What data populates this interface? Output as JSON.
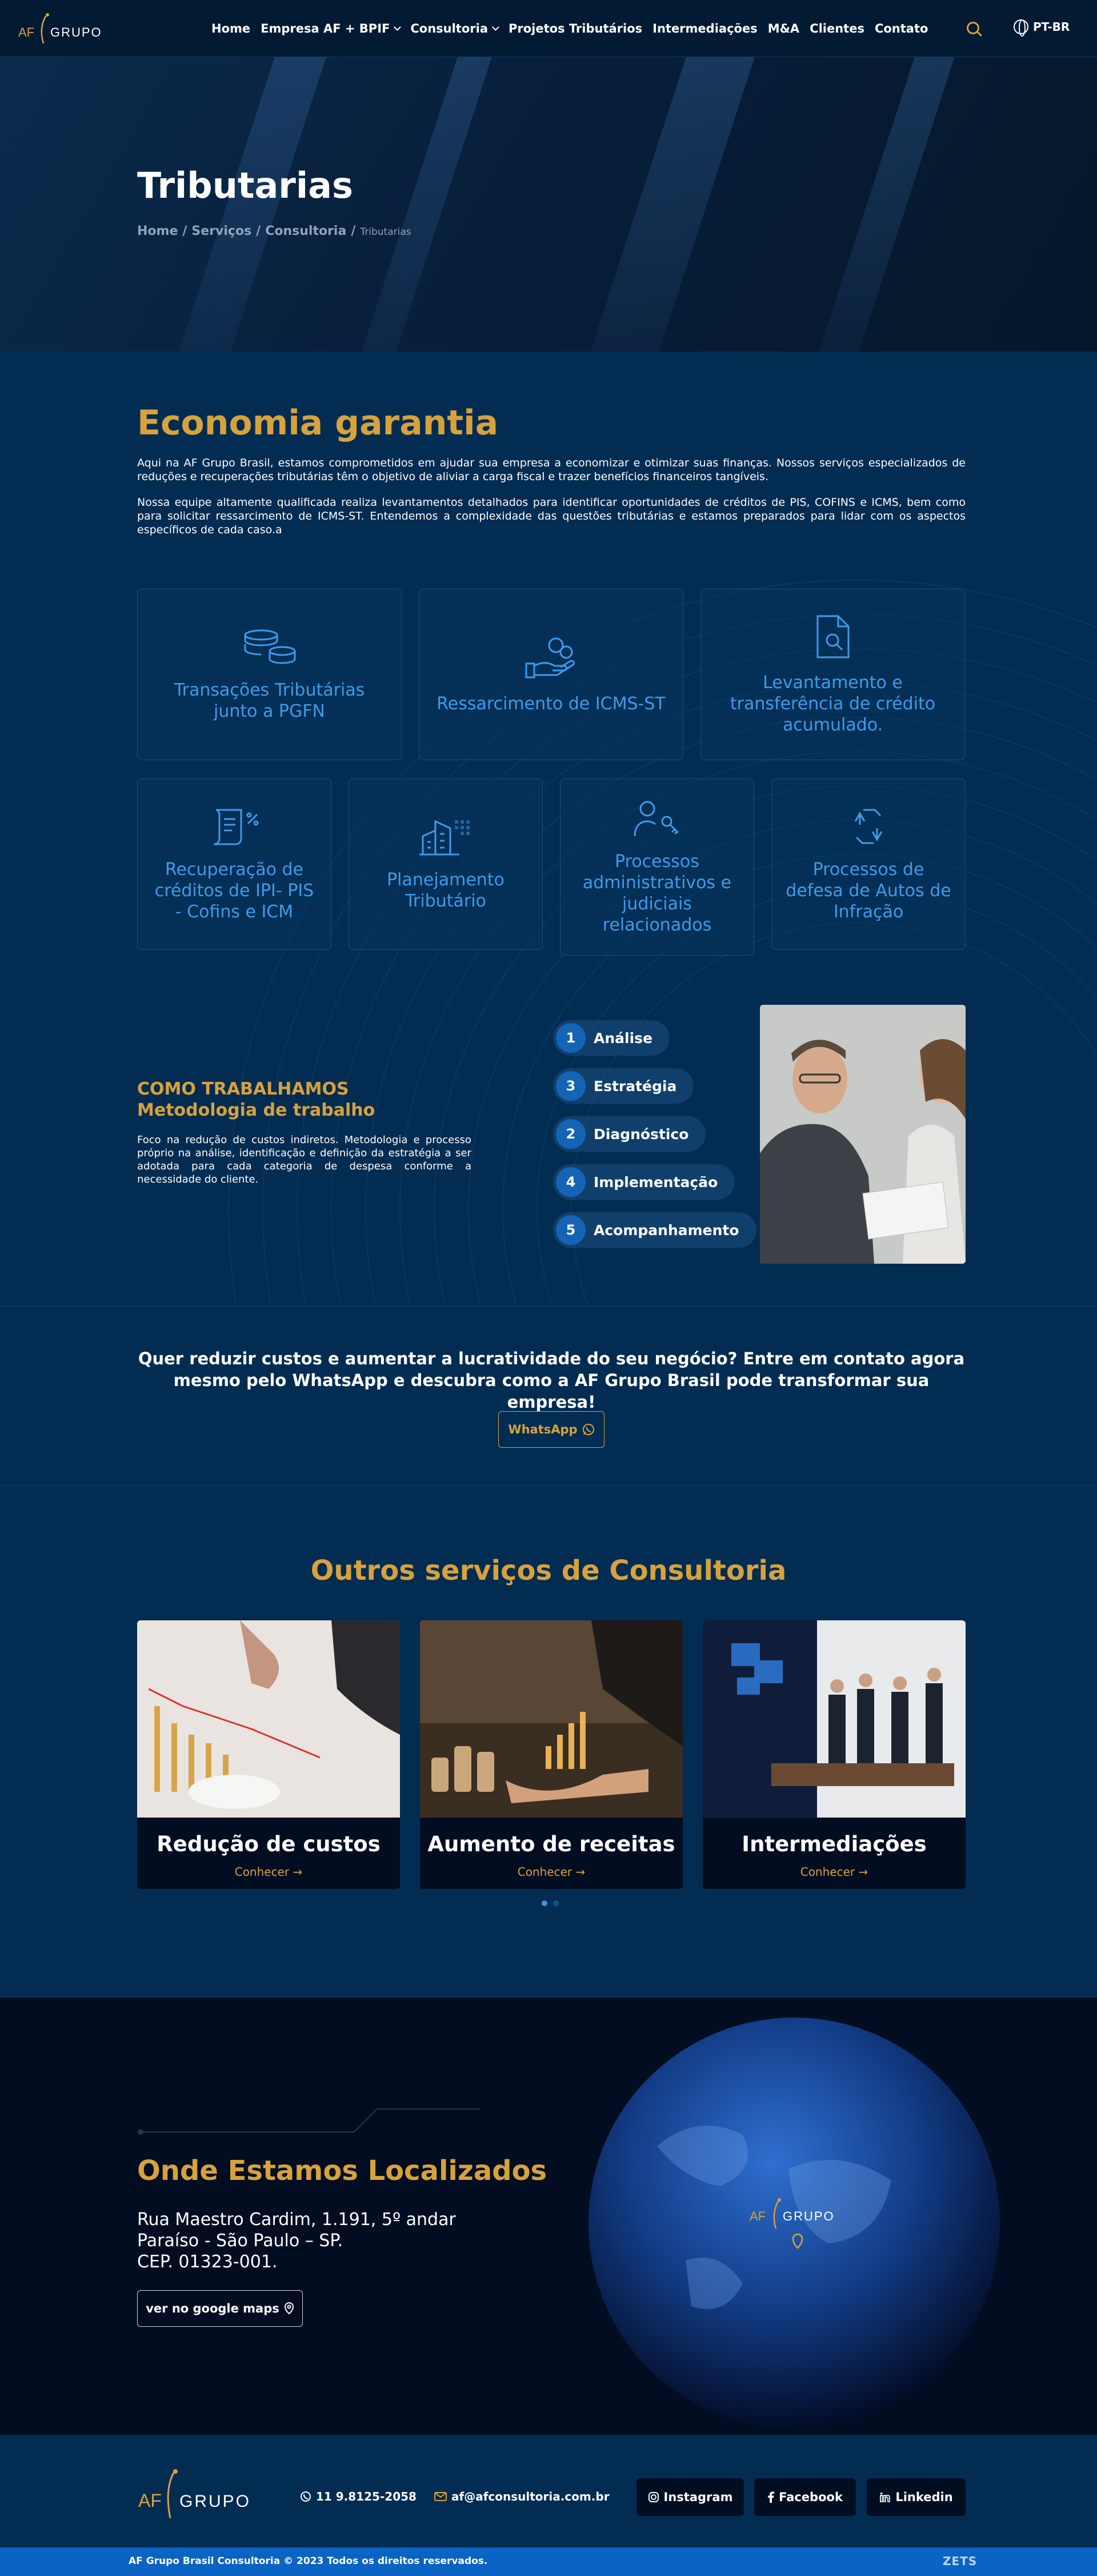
{
  "header": {
    "logo_left": "AF",
    "logo_right": "GRUPO",
    "nav": [
      {
        "label": "Home",
        "dropdown": false
      },
      {
        "label": "Empresa AF + BPIF",
        "dropdown": true
      },
      {
        "label": "Consultoria",
        "dropdown": true
      },
      {
        "label": "Projetos Tributários",
        "dropdown": false
      },
      {
        "label": "Intermediações",
        "dropdown": false
      },
      {
        "label": "M&A",
        "dropdown": false
      },
      {
        "label": "Clientes",
        "dropdown": false
      },
      {
        "label": "Contato",
        "dropdown": false
      }
    ],
    "language": "PT-BR"
  },
  "hero": {
    "title": "Tributarias",
    "breadcrumb": [
      "Home",
      "Serviços",
      "Consultoria"
    ],
    "breadcrumb_current": "Tributarias",
    "separator": "/"
  },
  "intro": {
    "title": "Economia garantia",
    "p1": "Aqui na AF Grupo Brasil, estamos comprometidos em ajudar sua empresa a economizar e otimizar suas finanças. Nossos serviços especializados de reduções e recuperações tributárias têm o objetivo de aliviar a carga fiscal e trazer benefícios financeiros tangíveis.",
    "p2": "Nossa equipe altamente qualificada realiza levantamentos detalhados para identificar oportunidades de créditos de PIS, COFINS e ICMS, bem como para solicitar ressarcimento de ICMS-ST. Entendemos a complexidade das questões tributárias e estamos preparados para lidar com os aspectos específicos de cada caso.a"
  },
  "services": [
    {
      "title": "Transações Tributárias junto a PGFN",
      "icon": "coins-icon"
    },
    {
      "title": "Ressarcimento de ICMS-ST",
      "icon": "hand-coin-icon"
    },
    {
      "title": "Levantamento e transferência de crédito acumulado.",
      "icon": "document-search-icon"
    },
    {
      "title": "Recuperação de créditos de IPI- PIS - Cofins e ICM",
      "icon": "scroll-percent-icon"
    },
    {
      "title": "Planejamento Tributário",
      "icon": "buildings-icon"
    },
    {
      "title": "Processos administrativos e judiciais relacionados",
      "icon": "person-key-icon"
    },
    {
      "title": "Processos de defesa de Autos de Infração",
      "icon": "arrows-cycle-icon"
    }
  ],
  "works": {
    "kicker": "COMO TRABALHAMOS",
    "title": "Metodologia de trabalho",
    "text": "Foco na redução de custos indiretos. Metodologia e processo próprio na análise, identificação e definição da estratégia a ser adotada para cada categoria de despesa conforme a necessidade do cliente.",
    "steps": [
      {
        "num": "1",
        "label": "Análise"
      },
      {
        "num": "3",
        "label": "Estratégia"
      },
      {
        "num": "2",
        "label": "Diagnóstico"
      },
      {
        "num": "4",
        "label": "Implementação"
      },
      {
        "num": "5",
        "label": "Acompanhamento"
      }
    ]
  },
  "cta": {
    "text": "Quer reduzir custos e aumentar a lucratividade do seu negócio? Entre em contato agora mesmo pelo WhatsApp e descubra como a AF Grupo Brasil pode transformar sua empresa!",
    "button": "WhatsApp"
  },
  "outros": {
    "title": "Outros serviços de Consultoria",
    "cards": [
      {
        "title": "Redução de custos",
        "link": "Conhecer"
      },
      {
        "title": "Aumento de receitas",
        "link": "Conhecer"
      },
      {
        "title": "Intermediações",
        "link": "Conhecer"
      }
    ]
  },
  "location": {
    "title": "Onde Estamos Localizados",
    "address": [
      "Rua Maestro Cardim, 1.191, 5º andar",
      "Paraíso - São Paulo – SP.",
      "CEP. 01323-001."
    ],
    "button": "ver no google maps"
  },
  "footer": {
    "phone": "11 9.8125-2058",
    "email": "af@afconsultoria.com.br",
    "social": [
      "Instagram",
      "Facebook",
      "Linkedin"
    ],
    "copyright": "AF Grupo Brasil Consultoria © 2023 Todos os direitos reservados.",
    "credit": "ZETS"
  },
  "colors": {
    "gold": "#d7a23c",
    "navy": "#032c52",
    "dark": "#020d22",
    "blue": "#3f9be8",
    "bar": "#0b63c4"
  }
}
